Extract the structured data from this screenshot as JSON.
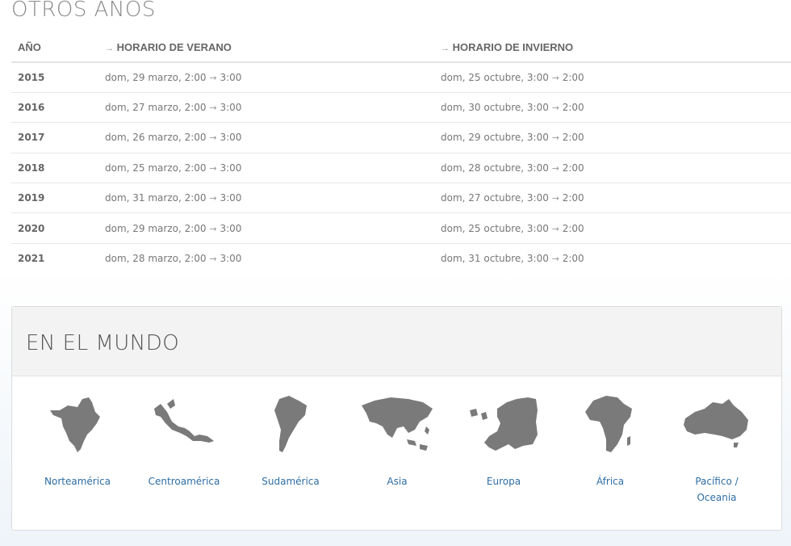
{
  "other_years": {
    "title": "OTROS AÑOS",
    "columns": {
      "year": "AÑO",
      "summer": "HORARIO DE VERANO",
      "winter": "HORARIO DE INVIERNO",
      "arrow": "→"
    },
    "rows": [
      {
        "year": "2015",
        "summer": "dom, 29 marzo, 2:00",
        "summer_to": "3:00",
        "winter": "dom, 25 octubre, 3:00",
        "winter_to": "2:00"
      },
      {
        "year": "2016",
        "summer": "dom, 27 marzo, 2:00",
        "summer_to": "3:00",
        "winter": "dom, 30 octubre, 3:00",
        "winter_to": "2:00"
      },
      {
        "year": "2017",
        "summer": "dom, 26 marzo, 2:00",
        "summer_to": "3:00",
        "winter": "dom, 29 octubre, 3:00",
        "winter_to": "2:00"
      },
      {
        "year": "2018",
        "summer": "dom, 25 marzo, 2:00",
        "summer_to": "3:00",
        "winter": "dom, 28 octubre, 3:00",
        "winter_to": "2:00"
      },
      {
        "year": "2019",
        "summer": "dom, 31 marzo, 2:00",
        "summer_to": "3:00",
        "winter": "dom, 27 octubre, 3:00",
        "winter_to": "2:00"
      },
      {
        "year": "2020",
        "summer": "dom, 29 marzo, 2:00",
        "summer_to": "3:00",
        "winter": "dom, 25 octubre, 3:00",
        "winter_to": "2:00"
      },
      {
        "year": "2021",
        "summer": "dom, 28 marzo, 2:00",
        "summer_to": "3:00",
        "winter": "dom, 31 octubre, 3:00",
        "winter_to": "2:00"
      }
    ]
  },
  "world": {
    "title": "EN EL MUNDO",
    "map_color": "#7a7a7a",
    "regions": [
      {
        "label": "Norteamérica",
        "icon": "north-america-map-icon"
      },
      {
        "label": "Centroamérica",
        "icon": "central-america-map-icon"
      },
      {
        "label": "Sudamérica",
        "icon": "south-america-map-icon"
      },
      {
        "label": "Asia",
        "icon": "asia-map-icon"
      },
      {
        "label": "Europa",
        "icon": "europe-map-icon"
      },
      {
        "label": "África",
        "icon": "africa-map-icon"
      },
      {
        "label": "Pacífico /",
        "label2": "Oceania",
        "icon": "oceania-map-icon"
      }
    ]
  }
}
